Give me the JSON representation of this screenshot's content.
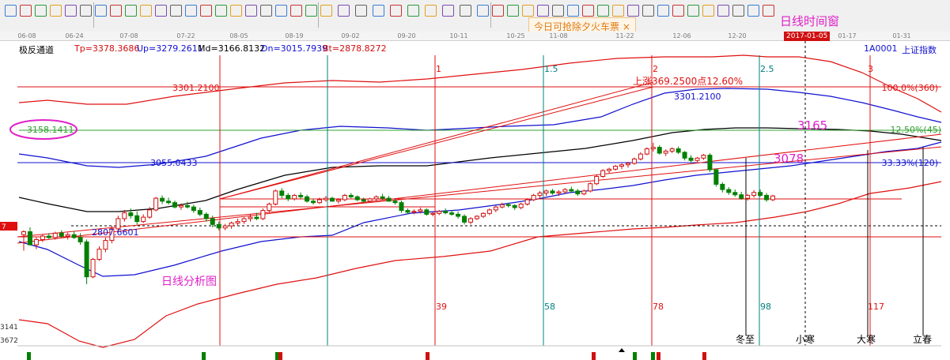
{
  "toolbar": {
    "ad_text": "今日可抢除夕火车票",
    "close_glyph": "×",
    "window_title": "日线时间窗"
  },
  "time_axis": {
    "ticks": [
      "06-08",
      "06-24",
      "07-08",
      "07-22",
      "08-05",
      "08-19",
      "09-02",
      "09-20",
      "10-11",
      "10-25",
      "11-08",
      "11-22",
      "12-06",
      "12-20",
      "01-17",
      "01-31"
    ],
    "current_date": "2017-01-05"
  },
  "header": {
    "indicator": "极反通道",
    "tp": "Tp=3378.3686",
    "up": "Up=3279.2611",
    "md": "Md=3166.8132",
    "dn": "Dn=3015.7939",
    "bt": "Bt=2878.8272",
    "symbol_code": "1A0001",
    "symbol_name": "上证指数"
  },
  "chart_data": {
    "type": "candlestick",
    "title": "",
    "xlabel": "",
    "ylabel": "",
    "ylim": [
      2600,
      3450
    ],
    "price_labels": {
      "high": "3301.2100",
      "circled": "3158.1411",
      "mid": "3055.0433",
      "low": "2807.6601"
    },
    "rise_annotation": "上涨369.2500点12.60%",
    "fib_labels": [
      "100.0%(360)",
      "12.50%(45)",
      "33.33%(120)"
    ],
    "target_labels": [
      "3165",
      "3078"
    ],
    "cycle_labels_top": [
      "1",
      "1.5",
      "2",
      "2.5",
      "3"
    ],
    "cycle_labels_bottom": [
      "39",
      "58",
      "78",
      "98",
      "117"
    ],
    "solar_terms": [
      "冬至",
      "小寒",
      "大寒",
      "立春"
    ],
    "chart_label": "日线分析图",
    "left_values": [
      "7",
      "3141",
      "3672"
    ],
    "channel_params": {
      "Tp": 3378.3686,
      "Up": 3279.2611,
      "Md": 3166.8132,
      "Dn": 3015.7939,
      "Bt": 2878.8272
    },
    "colors": {
      "up": "#d01010",
      "down": "#008000",
      "red_line": "#e01010",
      "blue_line": "#1010d0",
      "teal_line": "#008080",
      "green_line": "#30a030",
      "magenta": "#e020c8"
    },
    "candles": [
      [
        2985,
        3000,
        2930,
        2995
      ],
      [
        2995,
        3010,
        2948,
        2950
      ],
      [
        2950,
        2975,
        2935,
        2968
      ],
      [
        2968,
        2985,
        2960,
        2980
      ],
      [
        2980,
        2990,
        2970,
        2975
      ],
      [
        2975,
        2995,
        2968,
        2990
      ],
      [
        2990,
        3000,
        2975,
        2980
      ],
      [
        2980,
        2992,
        2968,
        2985
      ],
      [
        2985,
        2998,
        2970,
        2975
      ],
      [
        2975,
        2990,
        2950,
        2960
      ],
      [
        2960,
        2968,
        2815,
        2840
      ],
      [
        2840,
        2905,
        2835,
        2900
      ],
      [
        2900,
        2945,
        2895,
        2935
      ],
      [
        2935,
        2975,
        2925,
        2965
      ],
      [
        2965,
        3015,
        2955,
        3005
      ],
      [
        3005,
        3050,
        3000,
        3040
      ],
      [
        3040,
        3070,
        3030,
        3060
      ],
      [
        3060,
        3075,
        3040,
        3050
      ],
      [
        3050,
        3065,
        3020,
        3030
      ],
      [
        3030,
        3055,
        3025,
        3045
      ],
      [
        3045,
        3080,
        3040,
        3070
      ],
      [
        3070,
        3115,
        3065,
        3110
      ],
      [
        3110,
        3120,
        3090,
        3100
      ],
      [
        3100,
        3112,
        3088,
        3095
      ],
      [
        3095,
        3102,
        3075,
        3080
      ],
      [
        3080,
        3092,
        3070,
        3085
      ],
      [
        3085,
        3098,
        3075,
        3080
      ],
      [
        3080,
        3088,
        3060,
        3068
      ],
      [
        3068,
        3078,
        3048,
        3055
      ],
      [
        3055,
        3062,
        3030,
        3040
      ],
      [
        3040,
        3050,
        3010,
        3020
      ],
      [
        3020,
        3030,
        3000,
        3008
      ],
      [
        3008,
        3022,
        3000,
        3015
      ],
      [
        3015,
        3030,
        3005,
        3025
      ],
      [
        3025,
        3040,
        3015,
        3030
      ],
      [
        3030,
        3045,
        3022,
        3040
      ],
      [
        3040,
        3055,
        3030,
        3045
      ],
      [
        3045,
        3060,
        3035,
        3040
      ],
      [
        3040,
        3075,
        3035,
        3068
      ],
      [
        3068,
        3095,
        3062,
        3090
      ],
      [
        3090,
        3140,
        3085,
        3135
      ],
      [
        3135,
        3145,
        3110,
        3120
      ],
      [
        3120,
        3128,
        3100,
        3108
      ],
      [
        3108,
        3125,
        3102,
        3120
      ],
      [
        3120,
        3130,
        3108,
        3115
      ],
      [
        3115,
        3122,
        3095,
        3100
      ],
      [
        3100,
        3108,
        3088,
        3095
      ],
      [
        3095,
        3112,
        3090,
        3105
      ],
      [
        3105,
        3118,
        3098,
        3110
      ],
      [
        3110,
        3115,
        3098,
        3100
      ],
      [
        3100,
        3110,
        3092,
        3105
      ],
      [
        3105,
        3125,
        3100,
        3120
      ],
      [
        3120,
        3128,
        3110,
        3115
      ],
      [
        3115,
        3120,
        3100,
        3105
      ],
      [
        3105,
        3112,
        3095,
        3100
      ],
      [
        3100,
        3112,
        3095,
        3108
      ],
      [
        3108,
        3120,
        3102,
        3115
      ],
      [
        3115,
        3125,
        3105,
        3110
      ],
      [
        3110,
        3118,
        3098,
        3100
      ],
      [
        3100,
        3108,
        3088,
        3095
      ],
      [
        3095,
        3102,
        3060,
        3068
      ],
      [
        3068,
        3075,
        3055,
        3062
      ],
      [
        3062,
        3072,
        3055,
        3065
      ],
      [
        3065,
        3078,
        3058,
        3070
      ],
      [
        3070,
        3075,
        3050,
        3055
      ],
      [
        3055,
        3062,
        3048,
        3058
      ],
      [
        3058,
        3070,
        3052,
        3065
      ],
      [
        3065,
        3075,
        3055,
        3060
      ],
      [
        3060,
        3068,
        3050,
        3055
      ],
      [
        3055,
        3065,
        3040,
        3048
      ],
      [
        3048,
        3055,
        3020,
        3028
      ],
      [
        3028,
        3045,
        3020,
        3040
      ],
      [
        3040,
        3052,
        3035,
        3048
      ],
      [
        3048,
        3062,
        3042,
        3058
      ],
      [
        3058,
        3075,
        3052,
        3070
      ],
      [
        3070,
        3085,
        3062,
        3080
      ],
      [
        3080,
        3095,
        3075,
        3088
      ],
      [
        3088,
        3095,
        3078,
        3085
      ],
      [
        3085,
        3090,
        3070,
        3078
      ],
      [
        3078,
        3095,
        3072,
        3090
      ],
      [
        3090,
        3110,
        3085,
        3105
      ],
      [
        3105,
        3125,
        3100,
        3120
      ],
      [
        3120,
        3135,
        3110,
        3128
      ],
      [
        3128,
        3140,
        3118,
        3135
      ],
      [
        3135,
        3142,
        3122,
        3128
      ],
      [
        3128,
        3138,
        3118,
        3132
      ],
      [
        3132,
        3145,
        3125,
        3140
      ],
      [
        3140,
        3150,
        3128,
        3135
      ],
      [
        3135,
        3142,
        3118,
        3125
      ],
      [
        3125,
        3140,
        3120,
        3135
      ],
      [
        3135,
        3165,
        3130,
        3160
      ],
      [
        3160,
        3190,
        3155,
        3185
      ],
      [
        3185,
        3210,
        3180,
        3205
      ],
      [
        3205,
        3215,
        3195,
        3210
      ],
      [
        3210,
        3225,
        3205,
        3220
      ],
      [
        3220,
        3230,
        3210,
        3225
      ],
      [
        3225,
        3235,
        3215,
        3230
      ],
      [
        3230,
        3250,
        3225,
        3245
      ],
      [
        3245,
        3268,
        3240,
        3262
      ],
      [
        3262,
        3285,
        3258,
        3280
      ],
      [
        3280,
        3301,
        3270,
        3285
      ],
      [
        3285,
        3292,
        3260,
        3265
      ],
      [
        3265,
        3278,
        3255,
        3272
      ],
      [
        3272,
        3285,
        3265,
        3280
      ],
      [
        3280,
        3288,
        3262,
        3268
      ],
      [
        3268,
        3272,
        3240,
        3248
      ],
      [
        3248,
        3258,
        3232,
        3240
      ],
      [
        3240,
        3252,
        3235,
        3248
      ],
      [
        3248,
        3262,
        3242,
        3258
      ],
      [
        3258,
        3265,
        3200,
        3208
      ],
      [
        3208,
        3212,
        3150,
        3158
      ],
      [
        3158,
        3165,
        3130,
        3140
      ],
      [
        3140,
        3148,
        3122,
        3130
      ],
      [
        3130,
        3140,
        3115,
        3122
      ],
      [
        3122,
        3132,
        3105,
        3110
      ],
      [
        3110,
        3125,
        3102,
        3120
      ],
      [
        3120,
        3138,
        3112,
        3130
      ],
      [
        3130,
        3140,
        3115,
        3120
      ],
      [
        3120,
        3128,
        3098,
        3105
      ],
      [
        3105,
        3122,
        3100,
        3118
      ]
    ]
  }
}
